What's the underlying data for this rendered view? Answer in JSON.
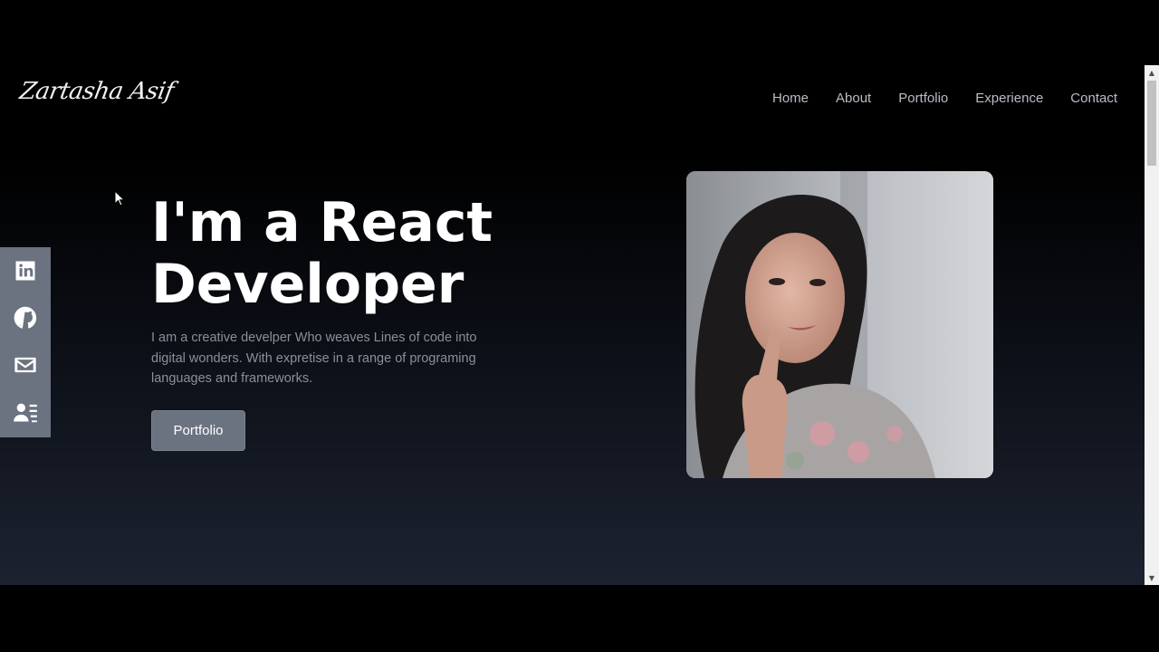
{
  "brand": {
    "logo_text": "Zartasha Asif"
  },
  "nav": {
    "items": [
      {
        "label": "Home"
      },
      {
        "label": "About"
      },
      {
        "label": "Portfolio"
      },
      {
        "label": "Experience"
      },
      {
        "label": "Contact"
      }
    ]
  },
  "social": {
    "icons": [
      "linkedin-icon",
      "github-icon",
      "mail-icon",
      "resume-icon"
    ]
  },
  "hero": {
    "title_line1": "I'm a React",
    "title_line2": "Developer",
    "description": "I am a creative develper Who weaves Lines of code into digital wonders. With expretise in a range of programing languages and frameworks.",
    "button_label": "Portfolio"
  },
  "colors": {
    "sidebar_bg": "#6b7280",
    "button_bg": "#6b7280",
    "nav_text": "#b9bdc6",
    "title_text": "#ffffff",
    "desc_text": "#8a8f99"
  }
}
